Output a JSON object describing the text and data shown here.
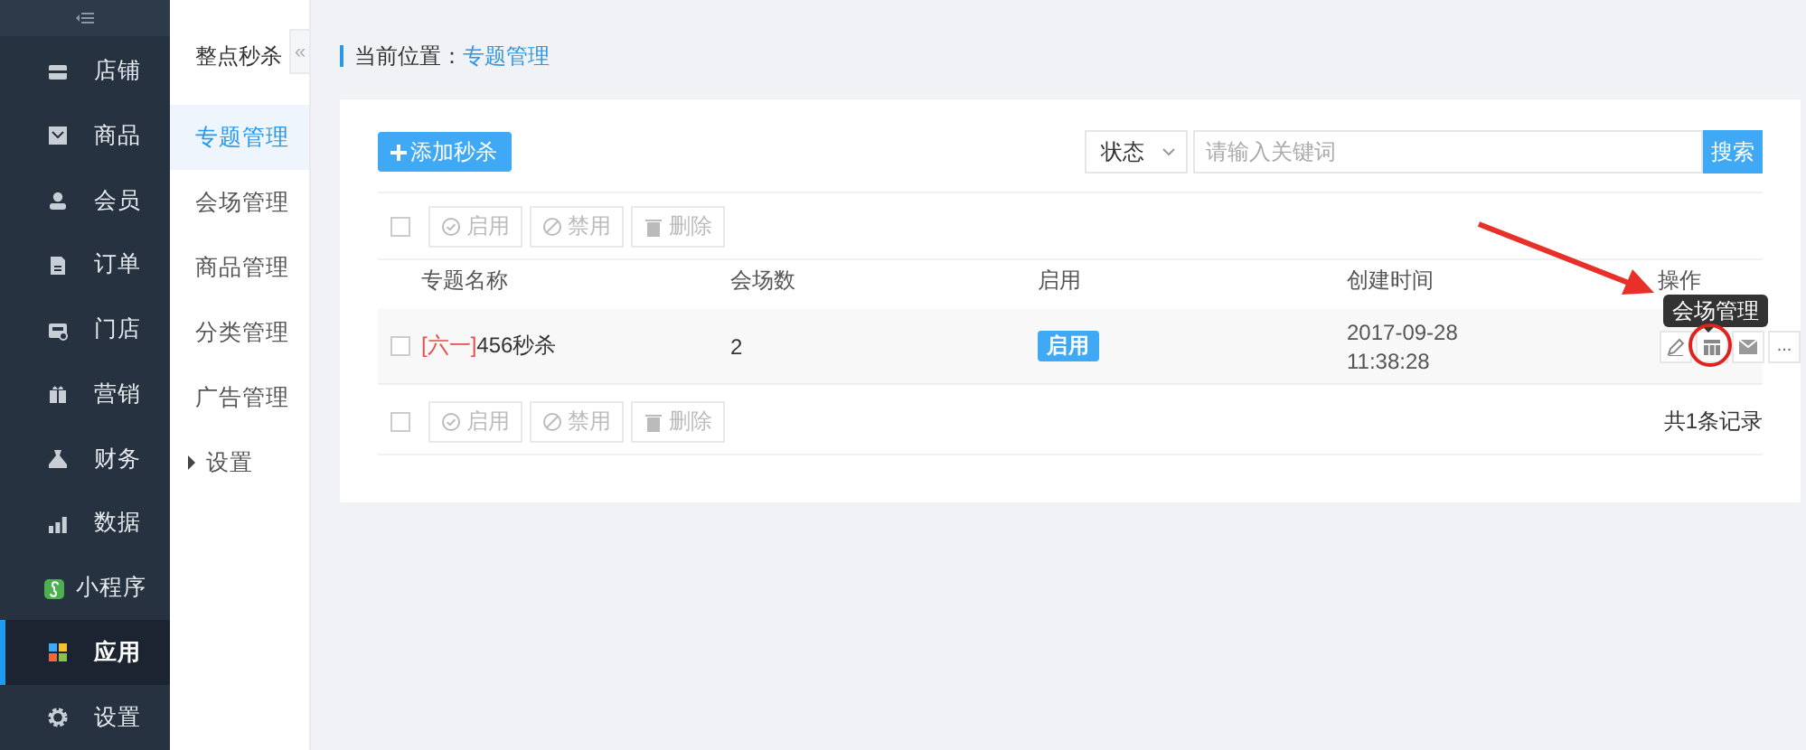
{
  "sidebar": {
    "items": [
      {
        "label": "店铺",
        "selected": false
      },
      {
        "label": "商品",
        "selected": false
      },
      {
        "label": "会员",
        "selected": false
      },
      {
        "label": "订单",
        "selected": false
      },
      {
        "label": "门店",
        "selected": false
      },
      {
        "label": "营销",
        "selected": false
      },
      {
        "label": "财务",
        "selected": false
      },
      {
        "label": "数据",
        "selected": false
      },
      {
        "label": "小程序",
        "selected": false
      },
      {
        "label": "应用",
        "selected": true
      },
      {
        "label": "设置",
        "selected": false
      }
    ]
  },
  "subnav": {
    "title": "整点秒杀",
    "collapse": "«",
    "items": [
      {
        "label": "专题管理",
        "selected": true
      },
      {
        "label": "会场管理",
        "selected": false
      },
      {
        "label": "商品管理",
        "selected": false
      },
      {
        "label": "分类管理",
        "selected": false
      },
      {
        "label": "广告管理",
        "selected": false
      },
      {
        "label": "设置",
        "selected": false,
        "expanded": false
      }
    ]
  },
  "breadcrumb": {
    "label": "当前位置：",
    "current": "专题管理"
  },
  "add_button": "添加秒杀",
  "filter": {
    "value": "状态"
  },
  "search": {
    "placeholder": "请输入关键词",
    "button": "搜索"
  },
  "bulk_actions_top": {
    "checked": false,
    "buttons": [
      "启用",
      "禁用",
      "删除"
    ]
  },
  "table": {
    "columns": [
      "专题名称",
      "会场数",
      "启用",
      "创建时间",
      "操作"
    ],
    "rows": [
      {
        "checked": false,
        "tag": "[六一]",
        "name": "456秒杀",
        "count": "2",
        "status": "启用",
        "created": "2017-09-28 11:38:28",
        "more": "..."
      }
    ]
  },
  "tooltip": "会场管理",
  "bulk_actions_bottom": {
    "checked": false,
    "buttons": [
      "启用",
      "禁用",
      "删除"
    ]
  },
  "record_count": "共1条记录"
}
